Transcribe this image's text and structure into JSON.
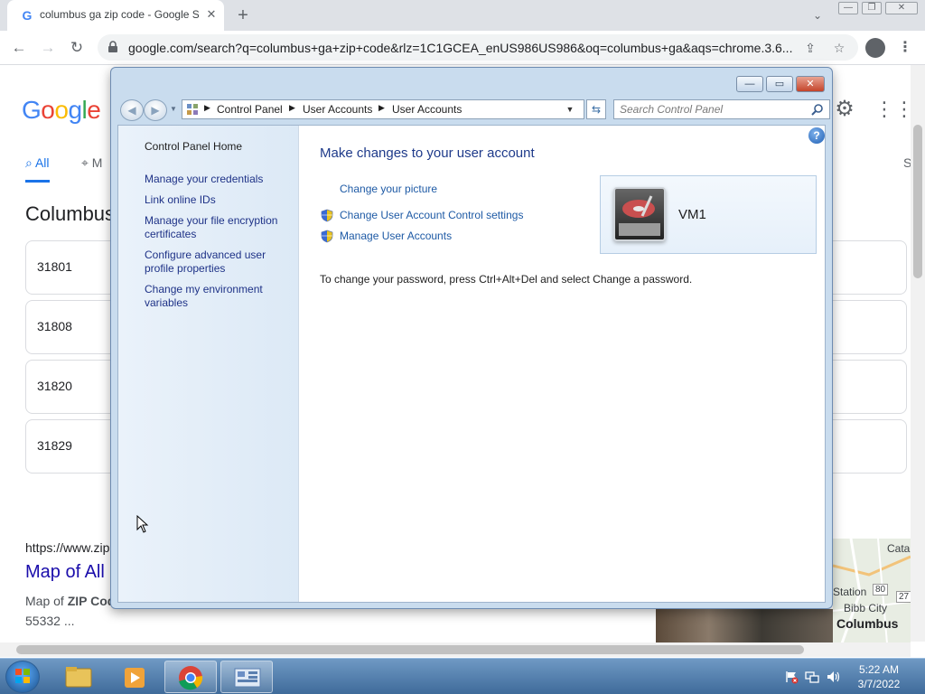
{
  "browser": {
    "tab_title": "columbus ga zip code - Google Search",
    "url": "google.com/search?q=columbus+ga+zip+code&rlz=1C1GCEA_enUS986US986&oq=columbus+ga&aqs=chrome.3.6..."
  },
  "google": {
    "tab_all": "All",
    "tab_maps": "M",
    "tab_more": "S",
    "heading": "Columbus",
    "zip_codes": [
      "31801",
      "31808",
      "31820",
      "31829"
    ],
    "result_cite": "https://www.zip",
    "result_title": "Map of All",
    "result_snippet_prefix": "Map of",
    "result_snippet_bold": "ZIP Cod",
    "result_snippet_line2": "55332 ...",
    "map_labels": {
      "cata": "Cata",
      "station": "Station",
      "road1": "80",
      "road2": "27",
      "bibb": "Bibb City",
      "columbus": "Columbus"
    }
  },
  "control_panel": {
    "breadcrumbs": [
      "Control Panel",
      "User Accounts",
      "User Accounts"
    ],
    "search_placeholder": "Search Control Panel",
    "sidebar": [
      "Control Panel Home",
      "Manage your credentials",
      "Link online IDs",
      "Manage your file encryption certificates",
      "Configure advanced user profile properties",
      "Change my environment variables"
    ],
    "heading": "Make changes to your user account",
    "tasks": {
      "change_picture": "Change your picture",
      "uac_settings": "Change User Account Control settings",
      "manage_accounts": "Manage User Accounts"
    },
    "password_note": "To change your password, press Ctrl+Alt+Del and select Change a password.",
    "account_name": "VM1"
  },
  "taskbar": {
    "time": "5:22 AM",
    "date": "3/7/2022"
  },
  "colors": {
    "link_blue": "#1e5aa5",
    "cp_heading": "#1e3a8a",
    "google_link": "#1a0dab",
    "taskbar": "#4f7cab"
  }
}
